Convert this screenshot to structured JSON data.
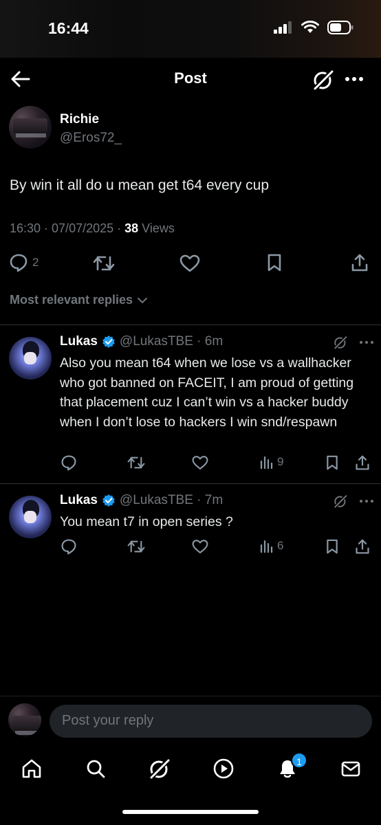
{
  "status_bar": {
    "time": "16:44"
  },
  "nav": {
    "title": "Post"
  },
  "post": {
    "author_name": "Richie",
    "author_handle": "@Eros72_",
    "text": "By win it all do u mean get t64 every cup",
    "timestamp": "16:30 · 07/07/2025 · ",
    "views_count": "38",
    "views_label": " Views",
    "reply_count": "2"
  },
  "sort": {
    "label": "Most relevant replies"
  },
  "replies": [
    {
      "name": "Lukas",
      "handle": "@LukasTBE · 6m",
      "text": "Also you mean t64 when we lose vs a wallhacker who got banned on FACEIT, I am proud of getting that placement cuz I can’t win vs a hacker buddy when I don’t lose to hackers I win snd/respawn",
      "views": "9"
    },
    {
      "name": "Lukas",
      "handle": "@LukasTBE · 7m",
      "text": "You mean t7 in open series ?",
      "views": "6"
    }
  ],
  "reply_bar": {
    "placeholder": "Post your reply"
  },
  "tab_bar": {
    "notification_badge": "1"
  },
  "colors": {
    "accent": "#1d9bf0",
    "muted": "#71767b",
    "background": "#000000"
  }
}
